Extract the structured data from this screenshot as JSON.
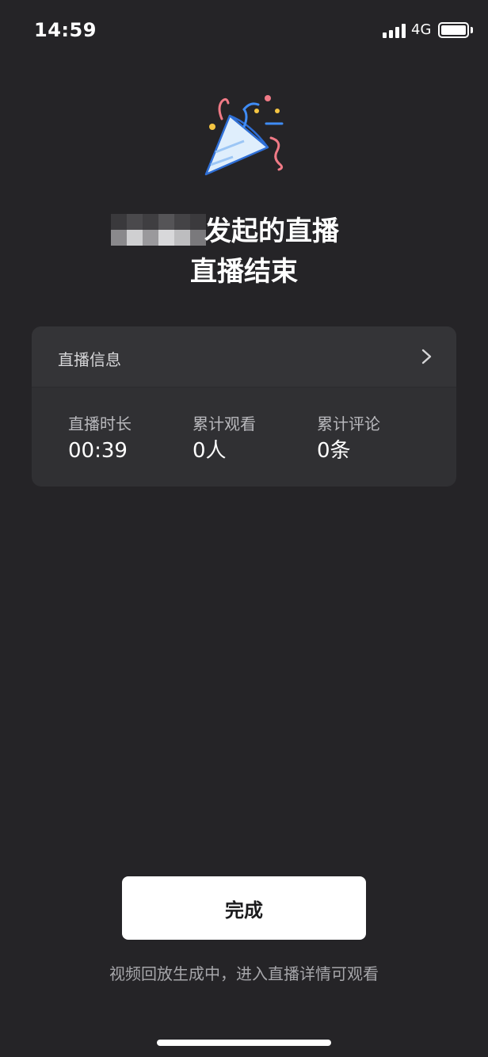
{
  "status_bar": {
    "time": "14:59",
    "network": "4G",
    "icons": [
      "signal-icon",
      "battery-icon"
    ]
  },
  "header": {
    "icon": "party-popper-icon",
    "title_line1_suffix": "发起的直播",
    "title_line2": "直播结束"
  },
  "info_card": {
    "title": "直播信息",
    "chevron_icon": "chevron-right-icon",
    "stats": [
      {
        "label": "直播时长",
        "value": "00:39"
      },
      {
        "label": "累计观看",
        "value": "0人"
      },
      {
        "label": "累计评论",
        "value": "0条"
      }
    ]
  },
  "actions": {
    "done_label": "完成",
    "hint": "视频回放生成中，进入直播详情可观看"
  },
  "colors": {
    "background": "#252427",
    "card": "#303033",
    "card_header": "#343437",
    "button": "#ffffff",
    "accent_blue": "#3f8cf5",
    "accent_pink": "#f07a86",
    "accent_yellow": "#f5c542"
  }
}
